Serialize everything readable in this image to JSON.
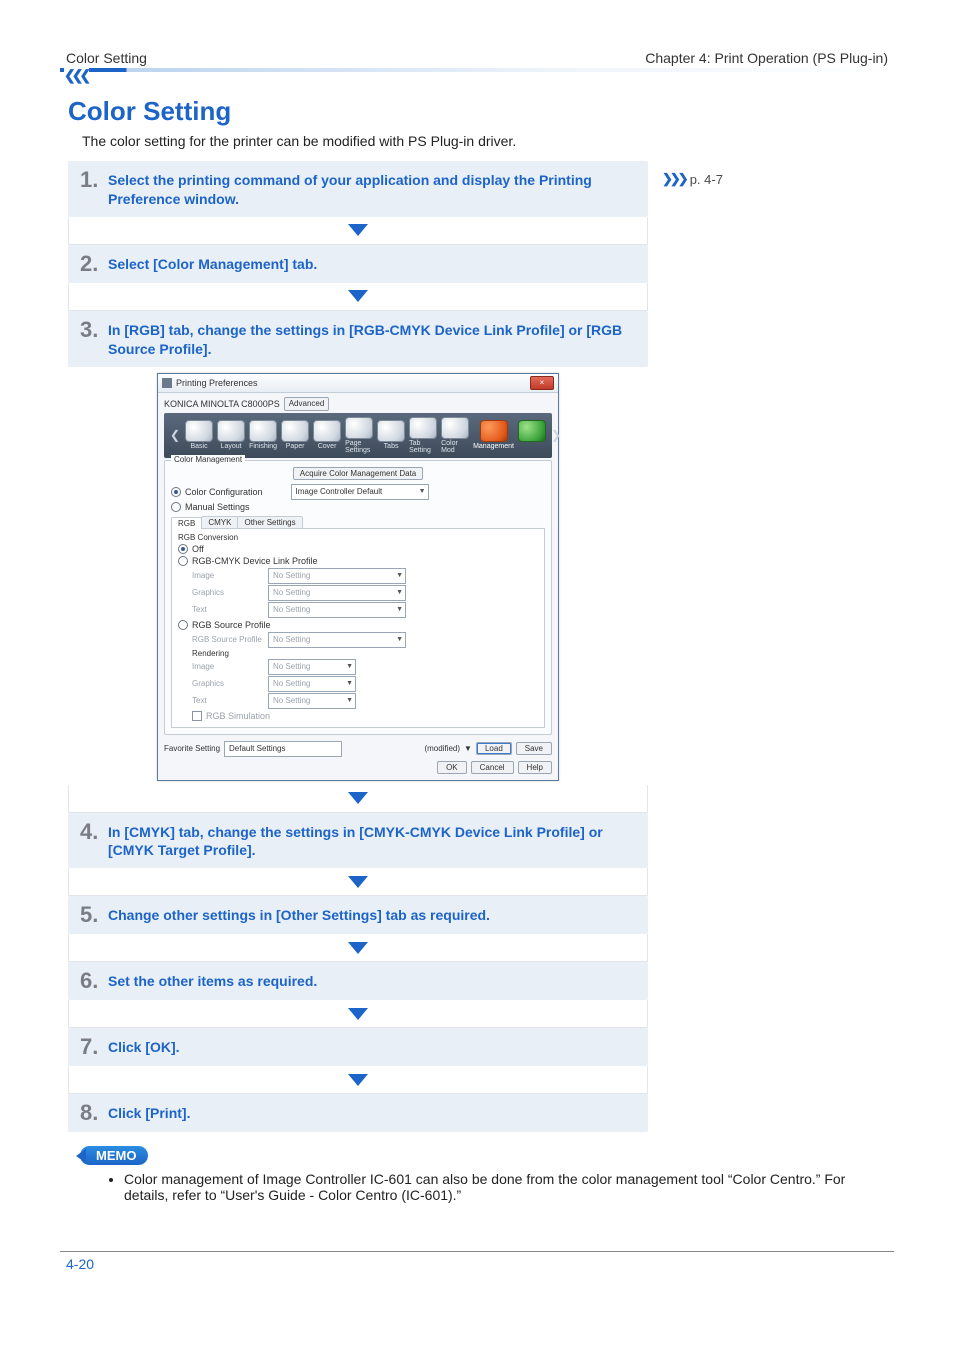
{
  "header": {
    "left": "Color Setting",
    "right": "Chapter 4: Print Operation (PS Plug-in)"
  },
  "title": "Color Setting",
  "intro": "The color setting for the printer can be modified with PS Plug-in driver.",
  "ref": {
    "label": "p. 4-7"
  },
  "steps": [
    {
      "num": "1.",
      "text": "Select the printing command of your application and display the Printing Preference window."
    },
    {
      "num": "2.",
      "text": "Select [Color Management] tab."
    },
    {
      "num": "3.",
      "text": "In [RGB] tab, change the settings in [RGB-CMYK Device Link Profile] or [RGB Source Profile]."
    },
    {
      "num": "4.",
      "text": "In [CMYK] tab, change the settings in [CMYK-CMYK Device Link Profile] or [CMYK Target Profile]."
    },
    {
      "num": "5.",
      "text": "Change other settings in [Other Settings] tab as required."
    },
    {
      "num": "6.",
      "text": "Set the other items as required."
    },
    {
      "num": "7.",
      "text": "Click [OK]."
    },
    {
      "num": "8.",
      "text": "Click [Print]."
    }
  ],
  "dialog": {
    "title": "Printing Preferences",
    "model": "KONICA MINOLTA C8000PS",
    "advanced_btn": "Advanced",
    "close_glyph": "×",
    "rail": {
      "items": [
        "Basic",
        "Layout",
        "Finishing",
        "Paper",
        "Cover",
        "Page Settings",
        "Tabs",
        "Tab Setting",
        "Color Mod",
        "Management"
      ],
      "selected_index": 9
    },
    "group_legend": "Color Management",
    "acquire_btn": "Acquire Color Management Data",
    "radios": {
      "color_config": "Color Configuration",
      "manual": "Manual Settings"
    },
    "config_combo": "Image Controller Default",
    "subtabs": [
      "RGB",
      "CMYK",
      "Other Settings"
    ],
    "rgb_section": {
      "legend": "RGB Conversion",
      "off": "Off",
      "dlp": "RGB-CMYK Device Link Profile",
      "src": "RGB Source Profile",
      "src_profile_lbl": "RGB Source Profile",
      "rendering": "Rendering",
      "rows": [
        "Image",
        "Graphics",
        "Text"
      ],
      "no_setting": "No Setting",
      "sim": "RGB Simulation"
    },
    "favorite": {
      "label": "Favorite Setting",
      "value": "Default Settings",
      "modified": "(modified)",
      "load": "Load",
      "save": "Save"
    },
    "buttons": {
      "ok": "OK",
      "cancel": "Cancel",
      "help": "Help"
    }
  },
  "memo": {
    "badge": "MEMO",
    "item": "Color management of Image Controller IC-601 can also be done from the color management tool “Color Centro.”  For details, refer to “User's Guide - Color Centro (IC-601).”"
  },
  "footer": {
    "page": "4-20"
  }
}
